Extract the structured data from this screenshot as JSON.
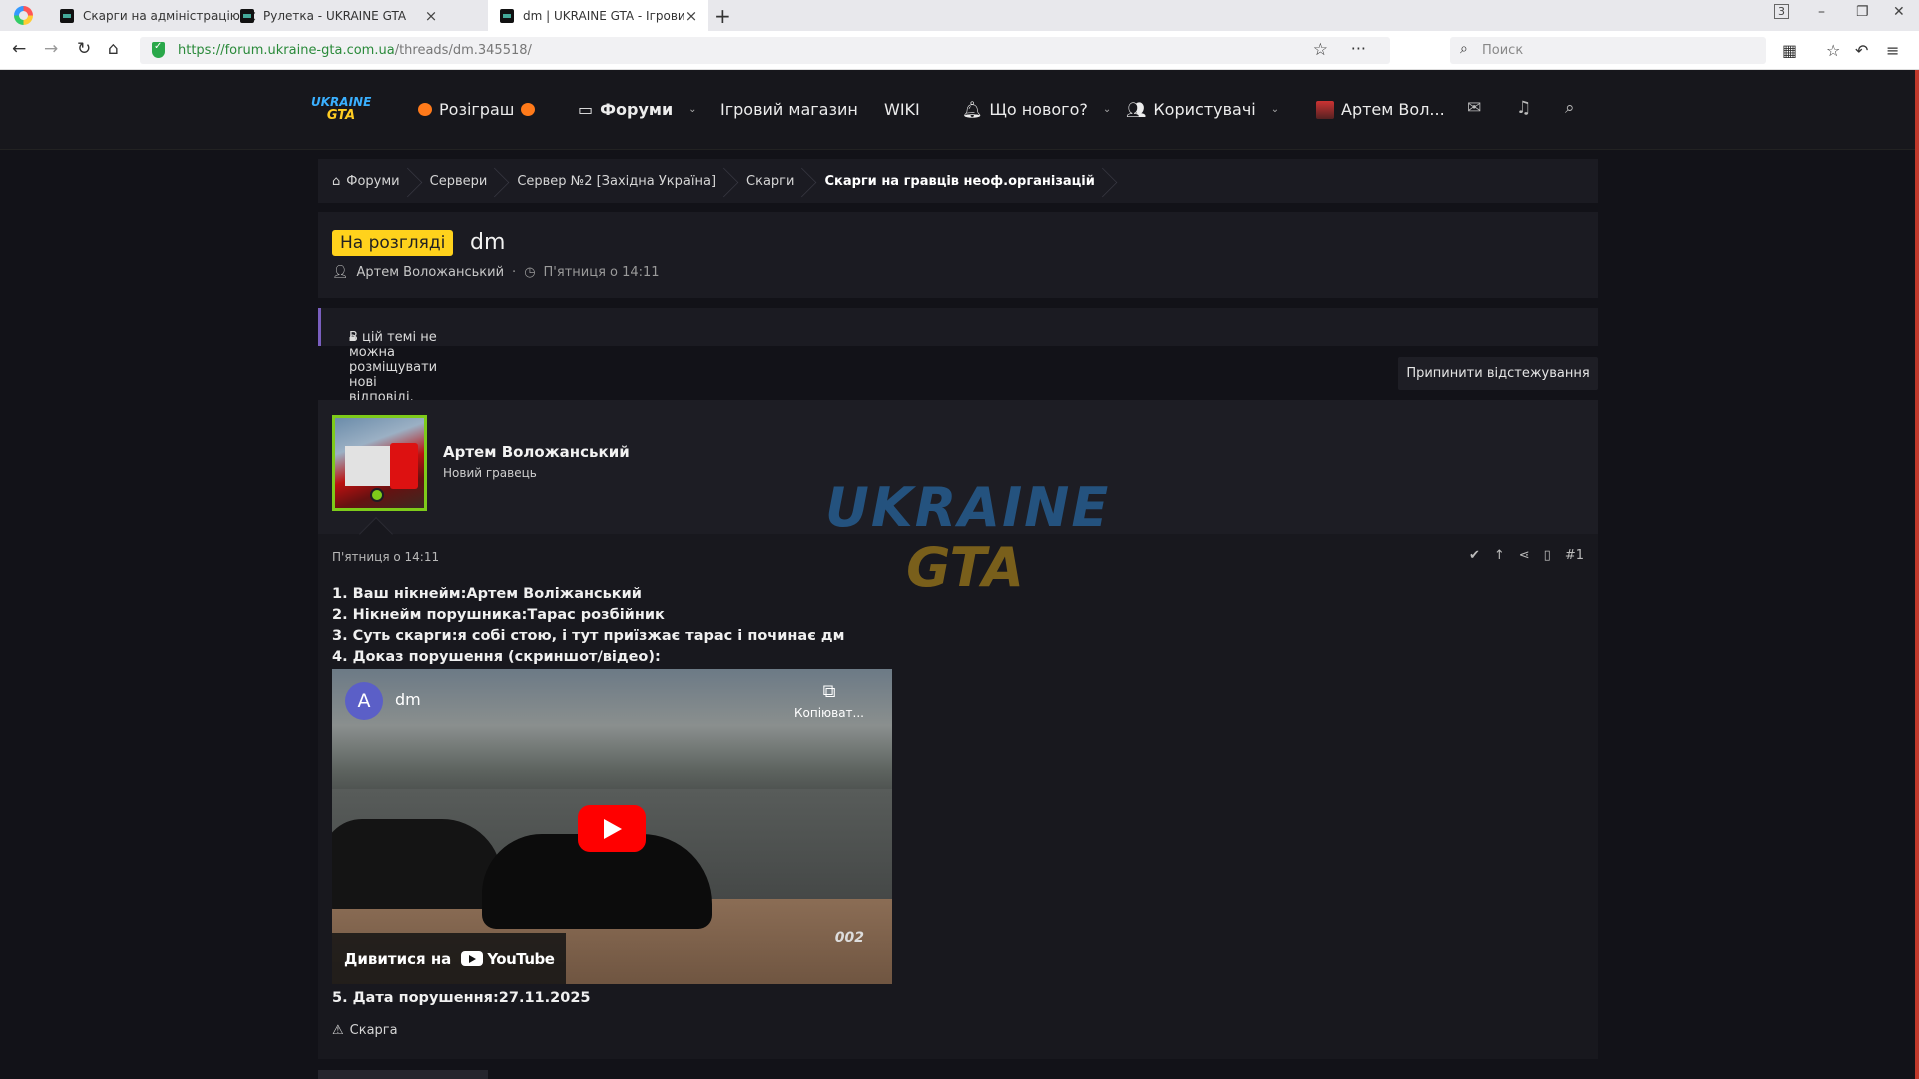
{
  "browser": {
    "tabs": [
      {
        "label": "Скарги на адміністрацію | Ukr"
      },
      {
        "label": "Рулетка - UKRAINE GTA"
      },
      {
        "label": "dm | UKRAINE GTA - Ігровий"
      }
    ],
    "url_base": "https://forum.ukraine-gta.com.ua",
    "url_path": "/threads/dm.345518/",
    "search_placeholder": "Поиск",
    "tab_count": "3"
  },
  "site": {
    "logo_line1": "UKRAINE",
    "logo_line2": "GTA",
    "nav": {
      "giveaway": "Розіграш",
      "forums": "Форуми",
      "shop": "Ігровий магазин",
      "wiki": "WIKI",
      "whats_new": "Що нового?",
      "users": "Користувачі",
      "account": "Артем Вол..."
    },
    "breadcrumbs": [
      "Форуми",
      "Сервери",
      "Сервер №2 [Західна Україна]",
      "Скарги",
      "Скарги на гравців неоф.організацій"
    ]
  },
  "thread": {
    "status_badge": "На розгляді",
    "title": "dm",
    "author": "Артем Воложанський",
    "date": "П'ятниця о 14:11",
    "locked_notice": "В цій темі не можна розміщувати нові відповіді.",
    "unwatch_label": "Припинити відстежування"
  },
  "post": {
    "author_name": "Артем Воложанський",
    "author_role": "Новий гравець",
    "date": "П'ятниця о 14:11",
    "number": "#1",
    "lines": [
      "1. Ваш нікнейм:Артем Воліжанський",
      "2. Нікнейм порушника:Тарас розбійник",
      "3. Суть скарги:я собі стою, і тут приїзжає тарас і починає дм",
      "4. Доказ порушення (скриншот/відео):"
    ],
    "video": {
      "channel_initial": "A",
      "title": "dm",
      "copy_label": "Копіюват...",
      "watch_on": "Дивитися на",
      "platform": "YouTube",
      "hud": "002"
    },
    "date_line": "5. Дата порушення:27.11.2025",
    "report_label": "Скарга"
  },
  "watermark": {
    "line1": "UKRAINE",
    "line2": "GTA"
  },
  "colors": {
    "badge": "#ffd21c",
    "avatar_border": "#7ecb1a",
    "notice_accent": "#7a5fbf",
    "page_bg": "#121218"
  }
}
